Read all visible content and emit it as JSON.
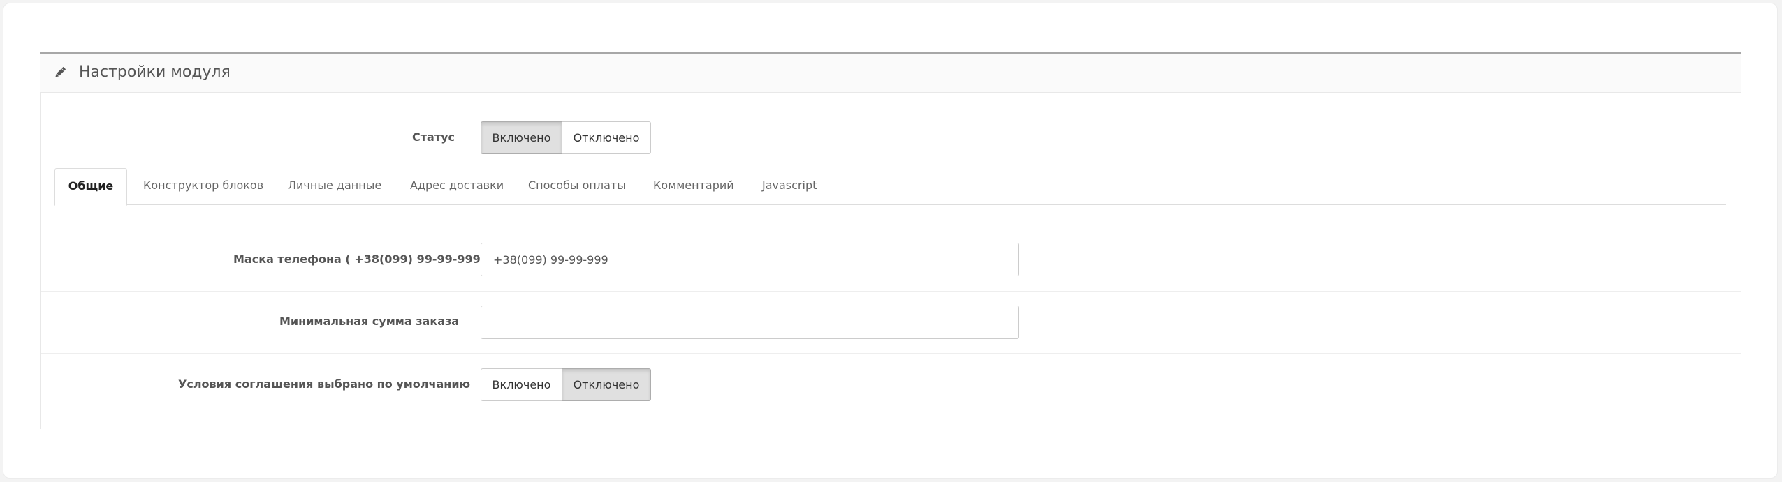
{
  "panel": {
    "title": "Настройки модуля",
    "icon": "pencil-icon"
  },
  "status": {
    "label": "Статус",
    "options": [
      "Включено",
      "Отключено"
    ],
    "selected": "Включено"
  },
  "tabs": [
    {
      "label": "Общие",
      "active": true
    },
    {
      "label": "Конструктор блоков",
      "active": false
    },
    {
      "label": "Личные данные",
      "active": false
    },
    {
      "label": "Адрес доставки",
      "active": false
    },
    {
      "label": "Способы оплаты",
      "active": false
    },
    {
      "label": "Комментарий",
      "active": false
    },
    {
      "label": "Javascript",
      "active": false
    }
  ],
  "fields": {
    "phone_mask": {
      "label": "Маска телефона ( +38(099) 99-99-999 )",
      "value": "+38(099) 99-99-999"
    },
    "min_order": {
      "label": "Минимальная сумма заказа",
      "value": ""
    },
    "agreement_default": {
      "label": "Условия соглашения выбрано по умолчанию",
      "options": [
        "Включено",
        "Отключено"
      ],
      "selected": "Отключено"
    }
  }
}
